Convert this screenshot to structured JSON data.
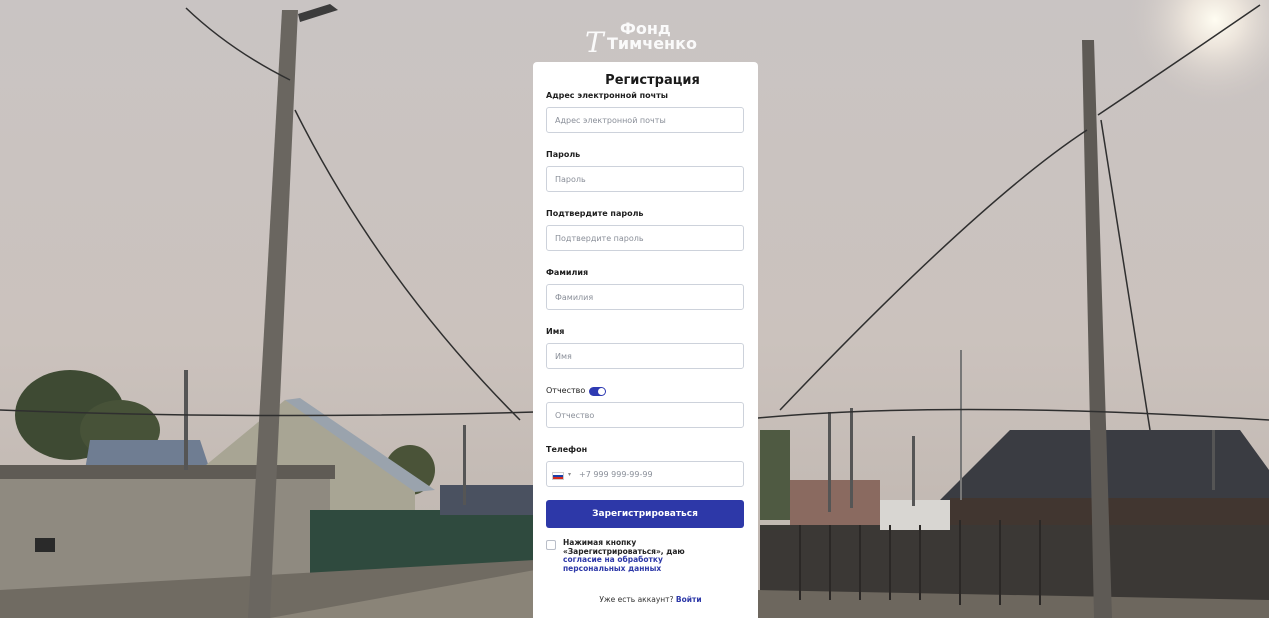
{
  "brand": {
    "logo_top": "Фонд",
    "logo_bottom": "Тимченко"
  },
  "form": {
    "title": "Регистрация",
    "fields": {
      "email": {
        "label": "Адрес электронной почты",
        "placeholder": "Адрес электронной почты"
      },
      "password": {
        "label": "Пароль",
        "placeholder": "Пароль"
      },
      "confirm_password": {
        "label": "Подтвердите пароль",
        "placeholder": "Подтвердите пароль"
      },
      "last_name": {
        "label": "Фамилия",
        "placeholder": "Фамилия"
      },
      "first_name": {
        "label": "Имя",
        "placeholder": "Имя"
      },
      "patronymic": {
        "label": "Отчество",
        "placeholder": "Отчество",
        "toggle_on": true
      },
      "phone": {
        "label": "Телефон",
        "placeholder": "+7 999 999-99-99"
      }
    },
    "submit_label": "Зарегистрироваться",
    "consent": {
      "text": "Нажимая кнопку «Зарегистрироваться», даю",
      "link": "согласие на обработку персональных данных"
    },
    "login": {
      "prompt": "Уже есть аккаунт?",
      "link": "Войти"
    }
  },
  "colors": {
    "accent": "#2d38a8",
    "toggle": "#2f3bb3"
  }
}
